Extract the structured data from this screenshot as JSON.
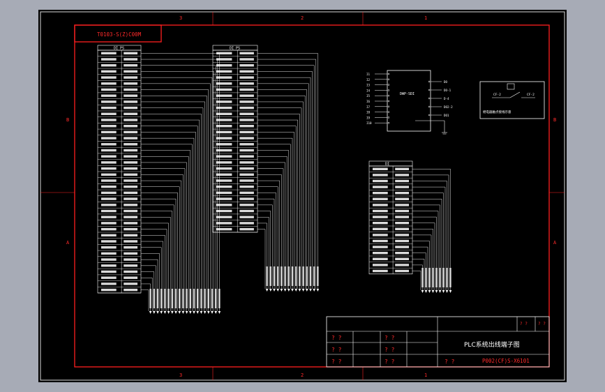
{
  "drawing": {
    "code_tag": "T0103-S(Z)C00M",
    "title": "PLC系统出线端子图",
    "drawing_no": "P002(CF)S-X6101",
    "q_mark": "? ?",
    "rev_cell": "? ?\n? ?"
  },
  "zones": {
    "top": [
      "3",
      "2",
      "1"
    ],
    "bottom": [
      "3",
      "2",
      "1"
    ],
    "left": [
      "B",
      "A"
    ],
    "right": [
      "B",
      "A"
    ]
  },
  "strips": [
    {
      "id": "strip-1",
      "header": "DI PS",
      "count": 40
    },
    {
      "id": "strip-2",
      "header": "DI PS",
      "count": 30
    },
    {
      "id": "strip-3",
      "header": "DI",
      "count": 18
    }
  ],
  "plc_block": {
    "module": "DWP-SDI",
    "inputs": [
      "I1",
      "I2",
      "I3",
      "I4",
      "I5",
      "I6",
      "I7",
      "I8",
      "I9",
      "I10"
    ],
    "outputs": [
      "DO",
      "DO-1",
      "D-4",
      "DO2-2",
      "DO1"
    ]
  },
  "detail_box": {
    "left_label": "CF-2",
    "right_label": "CF-2",
    "caption": "继电器触点接线示意"
  }
}
